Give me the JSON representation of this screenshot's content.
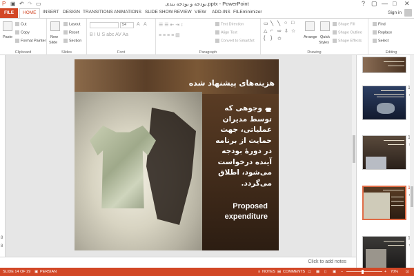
{
  "window": {
    "title": "بودجه و بودجه بندی.pptx - PowerPoint",
    "quick_access": [
      "save-icon",
      "undo-icon",
      "redo-icon",
      "start-from-beginning-icon"
    ],
    "controls": {
      "help": "?",
      "restore": "▢",
      "minimize": "—",
      "maximize": "□",
      "close": "✕"
    }
  },
  "tabs": {
    "file": "FILE",
    "items": [
      "HOME",
      "INSERT",
      "DESIGN",
      "TRANSITIONS",
      "ANIMATIONS",
      "SLIDE SHOW",
      "REVIEW",
      "VIEW",
      "ADD-INS",
      "FILEminimizer"
    ],
    "active": "HOME",
    "sign_in": "Sign in"
  },
  "ribbon": {
    "clipboard": {
      "paste": "Paste",
      "cut": "Cut",
      "copy": "Copy",
      "format_painter": "Format Painter",
      "label": "Clipboard"
    },
    "slides": {
      "new_slide": "New",
      "new_slide2": "Slide",
      "layout": "Layout",
      "reset": "Reset",
      "section": "Section",
      "label": "Slides"
    },
    "font": {
      "size": "54",
      "label": "Font"
    },
    "paragraph": {
      "text_direction": "Text Direction",
      "align_text": "Align Text",
      "convert": "Convert to SmartArt",
      "label": "Paragraph"
    },
    "drawing": {
      "arrange": "Arrange",
      "quick_styles": "Quick",
      "quick_styles2": "Styles",
      "shape_fill": "Shape Fill",
      "shape_outline": "Shape Outline",
      "shape_effects": "Shape Effects",
      "label": "Drawing"
    },
    "editing": {
      "find": "Find",
      "replace": "Replace",
      "select": "Select",
      "label": "Editing"
    }
  },
  "slide": {
    "title": "هزینه‌های پیشنهاد شده",
    "body_lines": [
      "به وجوهی که",
      "توسط مدیران",
      "عملیاتی، جهت",
      "حمایت از برنامه",
      "در دورۀ بودجه",
      "آینده درخواست",
      "می‌شود، اطلاق",
      "می‌گردد."
    ],
    "english": [
      "Proposed",
      "expenditure"
    ],
    "notes_placeholder": "Click to add notes"
  },
  "thumbnails": [
    {
      "number": "12",
      "star": "★"
    },
    {
      "number": "13",
      "star": "★"
    },
    {
      "number": "14",
      "star": "★",
      "selected": true
    },
    {
      "number": "15",
      "star": "★"
    }
  ],
  "left_markers": [
    "8",
    "8"
  ],
  "status": {
    "slide": "SLIDE 14 OF 29",
    "language": "PERSIAN",
    "notes": "NOTES",
    "comments": "COMMENTS",
    "zoom": "70%"
  }
}
